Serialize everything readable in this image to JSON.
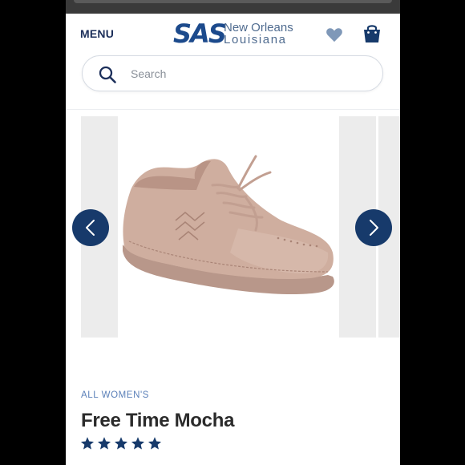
{
  "header": {
    "menu_label": "MENU",
    "logo_mark": "SAS",
    "logo_line1": "New Orleans",
    "logo_line2": "Louisiana",
    "wishlist_icon": "heart-icon",
    "cart_icon": "shopping-bag-icon"
  },
  "search": {
    "placeholder": "Search",
    "value": "",
    "icon": "search-icon"
  },
  "gallery": {
    "prev_icon": "chevron-left-icon",
    "next_icon": "chevron-right-icon",
    "image": "shoe-photo"
  },
  "product": {
    "category": "ALL WOMEN'S",
    "title": "Free Time Mocha",
    "rating": 5,
    "rating_max": 5
  },
  "colors": {
    "brand_navy": "#173a6b",
    "category_blue": "#5a7fb8",
    "heart": "#7f98b8",
    "shoe": "#c9a89a"
  }
}
